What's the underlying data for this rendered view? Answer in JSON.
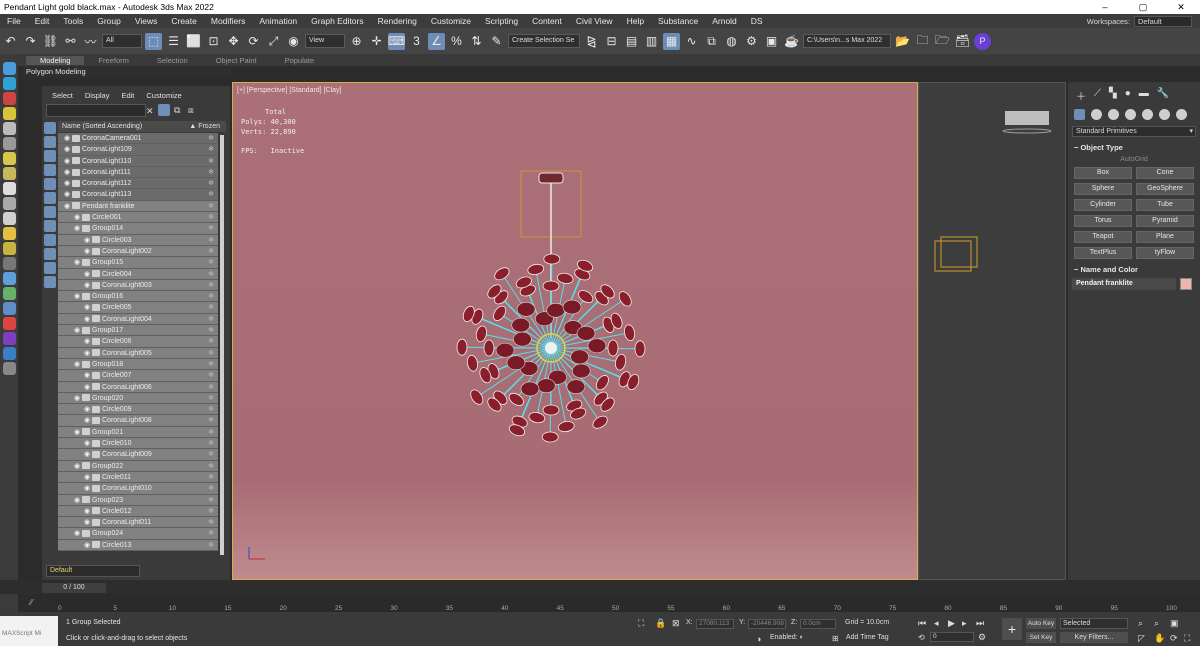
{
  "title": "Pendant Light gold black.max - Autodesk 3ds Max 2022",
  "menu": [
    "File",
    "Edit",
    "Tools",
    "Group",
    "Views",
    "Create",
    "Modifiers",
    "Animation",
    "Graph Editors",
    "Rendering",
    "Customize",
    "Scripting",
    "Content",
    "Civil View",
    "Help",
    "Substance",
    "Arnold",
    "DS"
  ],
  "workspaces": {
    "label": "Workspaces:",
    "value": "Default"
  },
  "toolbar": {
    "filter": "All",
    "refcoord": "View",
    "selection_set": "Create Selection Se",
    "path": "C:\\Users\\n...s Max 2022"
  },
  "ribbon": {
    "tabs": [
      "Modeling",
      "Freeform",
      "Selection",
      "Object Paint",
      "Populate"
    ],
    "active_tab": "Modeling",
    "subbar": "Polygon Modeling"
  },
  "explorer": {
    "menu": [
      "Select",
      "Display",
      "Edit",
      "Customize"
    ],
    "header": "Name (Sorted Ascending)",
    "frozen_header": "▲ Frozen",
    "rows": [
      {
        "name": "CoronaCamera001",
        "indent": 0,
        "sel": false
      },
      {
        "name": "CoronaLight109",
        "indent": 0,
        "sel": false
      },
      {
        "name": "CoronaLight110",
        "indent": 0,
        "sel": false
      },
      {
        "name": "CoronaLight111",
        "indent": 0,
        "sel": false
      },
      {
        "name": "CoronaLight112",
        "indent": 0,
        "sel": false
      },
      {
        "name": "CoronaLight113",
        "indent": 0,
        "sel": false
      },
      {
        "name": "Pendant franklite",
        "indent": 0,
        "sel": true
      },
      {
        "name": "Circle001",
        "indent": 1,
        "sel": true
      },
      {
        "name": "Group014",
        "indent": 1,
        "sel": true
      },
      {
        "name": "Circle003",
        "indent": 2,
        "sel": true
      },
      {
        "name": "CoronaLight002",
        "indent": 2,
        "sel": true
      },
      {
        "name": "Group015",
        "indent": 1,
        "sel": true
      },
      {
        "name": "Circle004",
        "indent": 2,
        "sel": true
      },
      {
        "name": "CoronaLight003",
        "indent": 2,
        "sel": true
      },
      {
        "name": "Group016",
        "indent": 1,
        "sel": true
      },
      {
        "name": "Circle005",
        "indent": 2,
        "sel": true
      },
      {
        "name": "CoronaLight004",
        "indent": 2,
        "sel": true
      },
      {
        "name": "Group017",
        "indent": 1,
        "sel": true
      },
      {
        "name": "Circle006",
        "indent": 2,
        "sel": true
      },
      {
        "name": "CoronaLight005",
        "indent": 2,
        "sel": true
      },
      {
        "name": "Group018",
        "indent": 1,
        "sel": true
      },
      {
        "name": "Circle007",
        "indent": 2,
        "sel": true
      },
      {
        "name": "CoronaLight006",
        "indent": 2,
        "sel": true
      },
      {
        "name": "Group020",
        "indent": 1,
        "sel": true
      },
      {
        "name": "Circle009",
        "indent": 2,
        "sel": true
      },
      {
        "name": "CoronaLight008",
        "indent": 2,
        "sel": true
      },
      {
        "name": "Group021",
        "indent": 1,
        "sel": true
      },
      {
        "name": "Circle010",
        "indent": 2,
        "sel": true
      },
      {
        "name": "CoronaLight009",
        "indent": 2,
        "sel": true
      },
      {
        "name": "Group022",
        "indent": 1,
        "sel": true
      },
      {
        "name": "Circle011",
        "indent": 2,
        "sel": true
      },
      {
        "name": "CoronaLight010",
        "indent": 2,
        "sel": true
      },
      {
        "name": "Group023",
        "indent": 1,
        "sel": true
      },
      {
        "name": "Circle012",
        "indent": 2,
        "sel": true
      },
      {
        "name": "CoronaLight011",
        "indent": 2,
        "sel": true
      },
      {
        "name": "Group024",
        "indent": 1,
        "sel": true
      },
      {
        "name": "Circle013",
        "indent": 2,
        "sel": true
      }
    ],
    "layer": "Default"
  },
  "viewport": {
    "label": "[+] [Perspective] [Standard] [Clay]",
    "stats_total": "Total",
    "polys_label": "Polys:",
    "polys": "40,300",
    "verts_label": "Verts:",
    "verts": "22,890",
    "fps_label": "FPS:",
    "fps": "Inactive"
  },
  "command_panel": {
    "category": "Standard Primitives",
    "object_type": "Object Type",
    "autogrid": "AutoGrid",
    "buttons": [
      "Box",
      "Cone",
      "Sphere",
      "GeoSphere",
      "Cylinder",
      "Tube",
      "Torus",
      "Pyramid",
      "Teapot",
      "Plane",
      "TextPlus",
      "tyFlow"
    ],
    "name_and_color": "Name and Color",
    "object_name": "Pendant franklite",
    "swatch_color": "#f0b4b0"
  },
  "timeline": {
    "frame": "0 / 100",
    "ticks": [
      "0",
      "5",
      "10",
      "15",
      "20",
      "25",
      "30",
      "35",
      "40",
      "45",
      "50",
      "55",
      "60",
      "65",
      "70",
      "75",
      "80",
      "85",
      "90",
      "95",
      "100"
    ]
  },
  "status": {
    "maxscript": "MAXScript Mi",
    "selected": "1 Group Selected",
    "prompt": "Click or click-and-drag to select objects",
    "x_label": "X:",
    "x": "27080.113",
    "y_label": "Y:",
    "y": "-20446.908",
    "z_label": "Z:",
    "z": "0.0cm",
    "grid": "Grid = 10.0cm",
    "enabled_label": "Enabled:",
    "add_time_tag": "Add Time Tag",
    "frame_field": "0",
    "auto_key": "Auto Key",
    "set_key": "Set Key",
    "key_selected": "Selected",
    "key_filters": "Key Filters..."
  }
}
